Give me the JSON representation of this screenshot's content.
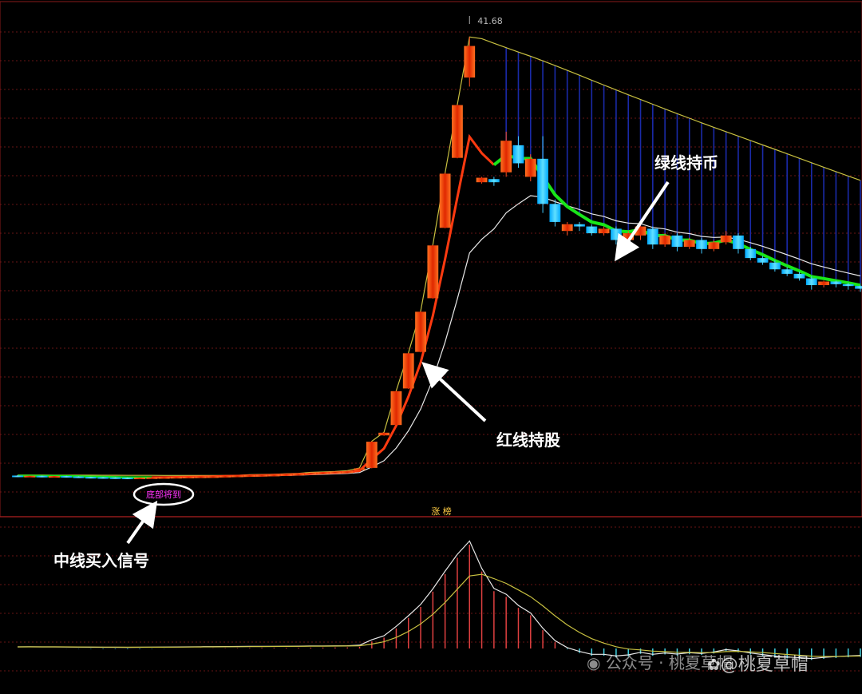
{
  "chart_data": {
    "type": "candlestick",
    "peak_price_label": "41.68",
    "signal_label": "底部将到",
    "divider_label": "涨 榜",
    "annotations": {
      "green_line": "绿线持币",
      "red_line": "红线持股",
      "buy_signal": "中线买入信号"
    },
    "candles": [
      {
        "o": 0.98,
        "c": 0.97,
        "h": 0.99,
        "l": 0.96
      },
      {
        "o": 0.97,
        "c": 0.975,
        "h": 0.98,
        "l": 0.96
      },
      {
        "o": 0.975,
        "c": 0.965,
        "h": 0.98,
        "l": 0.955
      },
      {
        "o": 0.965,
        "c": 0.97,
        "h": 0.975,
        "l": 0.96
      },
      {
        "o": 0.97,
        "c": 0.96,
        "h": 0.975,
        "l": 0.95
      },
      {
        "o": 0.96,
        "c": 0.95,
        "h": 0.965,
        "l": 0.94
      },
      {
        "o": 0.95,
        "c": 0.945,
        "h": 0.955,
        "l": 0.94
      },
      {
        "o": 0.945,
        "c": 0.94,
        "h": 0.95,
        "l": 0.935
      },
      {
        "o": 0.94,
        "c": 0.935,
        "h": 0.945,
        "l": 0.93
      },
      {
        "o": 0.935,
        "c": 0.93,
        "h": 0.94,
        "l": 0.925
      },
      {
        "o": 0.93,
        "c": 0.935,
        "h": 0.94,
        "l": 0.925
      },
      {
        "o": 0.935,
        "c": 0.94,
        "h": 0.945,
        "l": 0.93
      },
      {
        "o": 0.94,
        "c": 0.945,
        "h": 0.95,
        "l": 0.935
      },
      {
        "o": 0.945,
        "c": 0.95,
        "h": 0.955,
        "l": 0.94
      },
      {
        "o": 0.95,
        "c": 0.955,
        "h": 0.96,
        "l": 0.945
      },
      {
        "o": 0.955,
        "c": 0.96,
        "h": 0.965,
        "l": 0.95
      },
      {
        "o": 0.96,
        "c": 0.965,
        "h": 0.97,
        "l": 0.955
      },
      {
        "o": 0.965,
        "c": 0.975,
        "h": 0.98,
        "l": 0.96
      },
      {
        "o": 0.975,
        "c": 0.98,
        "h": 0.985,
        "l": 0.97
      },
      {
        "o": 0.98,
        "c": 0.99,
        "h": 1.0,
        "l": 0.975
      },
      {
        "o": 0.99,
        "c": 0.995,
        "h": 1.005,
        "l": 0.985
      },
      {
        "o": 0.995,
        "c": 1.0,
        "h": 1.01,
        "l": 0.99
      },
      {
        "o": 1.0,
        "c": 1.01,
        "h": 1.02,
        "l": 0.995
      },
      {
        "o": 1.01,
        "c": 1.02,
        "h": 1.03,
        "l": 1.0
      },
      {
        "o": 1.02,
        "c": 1.04,
        "h": 1.05,
        "l": 1.01
      },
      {
        "o": 1.04,
        "c": 1.05,
        "h": 1.06,
        "l": 1.03
      },
      {
        "o": 1.05,
        "c": 1.06,
        "h": 1.07,
        "l": 1.04
      },
      {
        "o": 1.06,
        "c": 1.07,
        "h": 1.09,
        "l": 1.05
      },
      {
        "o": 1.1,
        "c": 1.14,
        "h": 1.15,
        "l": 1.1
      },
      {
        "o": 1.15,
        "c": 1.73,
        "h": 1.74,
        "l": 1.14
      },
      {
        "o": 1.87,
        "c": 1.93,
        "h": 1.94,
        "l": 1.86
      },
      {
        "o": 2.1,
        "c": 2.85,
        "h": 2.86,
        "l": 2.09
      },
      {
        "o": 2.91,
        "c": 3.69,
        "h": 3.7,
        "l": 2.9
      },
      {
        "o": 3.72,
        "c": 4.61,
        "h": 4.62,
        "l": 3.71
      },
      {
        "o": 4.91,
        "c": 6.08,
        "h": 6.09,
        "l": 4.9
      },
      {
        "o": 6.47,
        "c": 7.67,
        "h": 7.69,
        "l": 6.46
      },
      {
        "o": 8.02,
        "c": 9.19,
        "h": 9.2,
        "l": 8.01
      },
      {
        "o": 9.8,
        "c": 10.5,
        "h": 10.7,
        "l": 9.6
      },
      {
        "o": 7.48,
        "c": 7.58,
        "h": 7.6,
        "l": 7.45
      },
      {
        "o": 7.55,
        "c": 7.48,
        "h": 7.6,
        "l": 7.4
      },
      {
        "o": 7.7,
        "c": 8.4,
        "h": 8.6,
        "l": 7.6
      },
      {
        "o": 8.3,
        "c": 7.9,
        "h": 8.5,
        "l": 7.8
      },
      {
        "o": 7.6,
        "c": 8.0,
        "h": 8.1,
        "l": 7.5
      },
      {
        "o": 8.0,
        "c": 7.0,
        "h": 8.5,
        "l": 6.8
      },
      {
        "o": 7.0,
        "c": 6.6,
        "h": 7.1,
        "l": 6.5
      },
      {
        "o": 6.4,
        "c": 6.55,
        "h": 6.6,
        "l": 6.3
      },
      {
        "o": 6.55,
        "c": 6.5,
        "h": 6.6,
        "l": 6.4
      },
      {
        "o": 6.5,
        "c": 6.35,
        "h": 6.55,
        "l": 6.3
      },
      {
        "o": 6.35,
        "c": 6.45,
        "h": 6.5,
        "l": 6.3
      },
      {
        "o": 6.45,
        "c": 6.2,
        "h": 6.5,
        "l": 6.1
      },
      {
        "o": 6.2,
        "c": 6.35,
        "h": 6.4,
        "l": 6.1
      },
      {
        "o": 6.3,
        "c": 6.5,
        "h": 6.6,
        "l": 6.2
      },
      {
        "o": 6.45,
        "c": 6.1,
        "h": 6.5,
        "l": 6.0
      },
      {
        "o": 6.1,
        "c": 6.3,
        "h": 6.35,
        "l": 6.05
      },
      {
        "o": 6.3,
        "c": 6.05,
        "h": 6.35,
        "l": 5.95
      },
      {
        "o": 6.05,
        "c": 6.2,
        "h": 6.25,
        "l": 6.0
      },
      {
        "o": 6.2,
        "c": 6.0,
        "h": 6.25,
        "l": 5.9
      },
      {
        "o": 6.0,
        "c": 6.15,
        "h": 6.2,
        "l": 5.95
      },
      {
        "o": 6.15,
        "c": 6.3,
        "h": 6.4,
        "l": 6.1
      },
      {
        "o": 6.3,
        "c": 6.0,
        "h": 6.35,
        "l": 5.9
      },
      {
        "o": 6.0,
        "c": 5.8,
        "h": 6.05,
        "l": 5.75
      },
      {
        "o": 5.8,
        "c": 5.7,
        "h": 5.85,
        "l": 5.65
      },
      {
        "o": 5.7,
        "c": 5.55,
        "h": 5.75,
        "l": 5.5
      },
      {
        "o": 5.55,
        "c": 5.45,
        "h": 5.6,
        "l": 5.4
      },
      {
        "o": 5.45,
        "c": 5.35,
        "h": 5.5,
        "l": 5.3
      },
      {
        "o": 5.35,
        "c": 5.2,
        "h": 5.4,
        "l": 5.1
      },
      {
        "o": 5.2,
        "c": 5.28,
        "h": 5.3,
        "l": 5.15
      },
      {
        "o": 5.28,
        "c": 5.22,
        "h": 5.3,
        "l": 5.15
      },
      {
        "o": 5.22,
        "c": 5.18,
        "h": 5.25,
        "l": 5.1
      },
      {
        "o": 5.18,
        "c": 5.12,
        "h": 5.2,
        "l": 5.05
      }
    ]
  },
  "watermark": {
    "channel": "公众号 · 桃夏草帽",
    "handle": "@桃夏草帽"
  },
  "colors": {
    "up": "#e03010",
    "down": "#30b8ff",
    "red_line": "#ff3a10",
    "green_line": "#19e619",
    "white_line": "#e8e8e8",
    "yellow_line": "#c8c040",
    "grid": "#8a1a1a",
    "fill": "#1a2aa8"
  }
}
